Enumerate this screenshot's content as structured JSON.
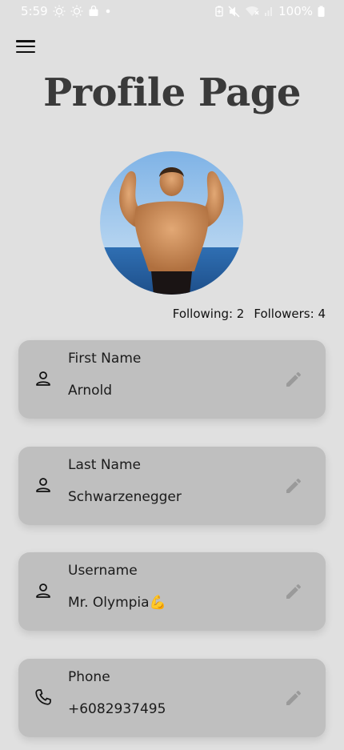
{
  "status_bar": {
    "time": "5:59",
    "battery": "100%",
    "icons": [
      "brightness-icon",
      "brightness-icon",
      "shopping-bag-icon",
      "dot-icon",
      "battery-saver-icon",
      "mute-icon",
      "wifi-icon",
      "signal-icon",
      "battery-icon"
    ]
  },
  "header": {
    "title": "Profile Page",
    "menu_icon": "hamburger-icon"
  },
  "profile": {
    "following": "Following: 2",
    "followers": "Followers: 4"
  },
  "fields": [
    {
      "label": "First Name",
      "value": "Arnold",
      "icon": "person-icon"
    },
    {
      "label": "Last Name",
      "value": "Schwarzenegger",
      "icon": "person-icon"
    },
    {
      "label": "Username",
      "value": "Mr. Olympia💪",
      "icon": "person-icon"
    },
    {
      "label": "Phone",
      "value": "+6082937495",
      "icon": "phone-icon"
    }
  ],
  "colors": {
    "background": "#e0e0e0",
    "card": "#bfbfbf",
    "title": "#3a3a3a",
    "edit_icon": "#9a9a9a"
  }
}
